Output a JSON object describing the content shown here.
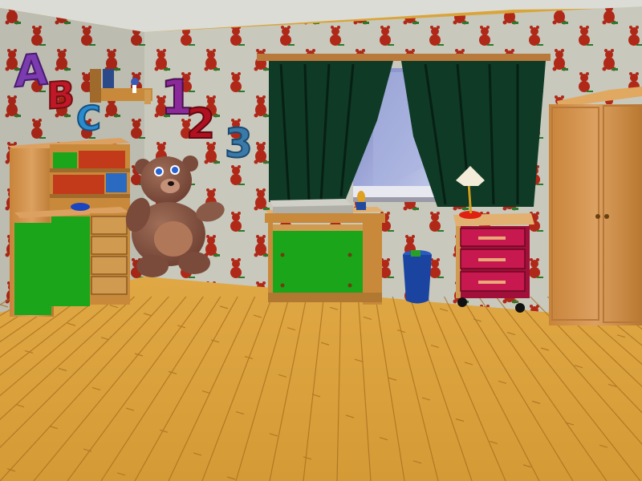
{
  "scene": {
    "kind": "3D nursery room render",
    "objects": [
      "teddy-bear-wallpaper",
      "letter-blocks",
      "number-blocks",
      "wall-shelf",
      "bookcase",
      "teddy-bear",
      "changing-table",
      "window",
      "curtains",
      "trash-bin",
      "nightstand",
      "table-lamp",
      "wardrobe",
      "wooden-floor"
    ]
  },
  "wall_letters": [
    "A",
    "B",
    "C"
  ],
  "wall_numbers": [
    "1",
    "2",
    "3"
  ],
  "colors": {
    "wallpaper": "#c8c8bc",
    "wallpaper_bear": "#b02818",
    "ceiling": "#dcdcd6",
    "floor": "#dba43c",
    "floor_light": "#e8b84e",
    "floor_plank_line": "#9a6418",
    "wood": "#c88a3a",
    "wood_light": "#dca060",
    "green_panel": "#1aa51a",
    "curtain": "#0f3a26",
    "window_sky": "#9aa8d8",
    "nightstand_body": "#a0103a",
    "lamp_base": "#e02010",
    "bin": "#1a44a0",
    "letter_A": "#7a3cae",
    "letter_B": "#c01828",
    "letter_C": "#2a8acc",
    "num_1": "#8a2a9a",
    "num_2": "#b01020",
    "num_3": "#3a7aa8",
    "teddy": "#8a5a48"
  }
}
